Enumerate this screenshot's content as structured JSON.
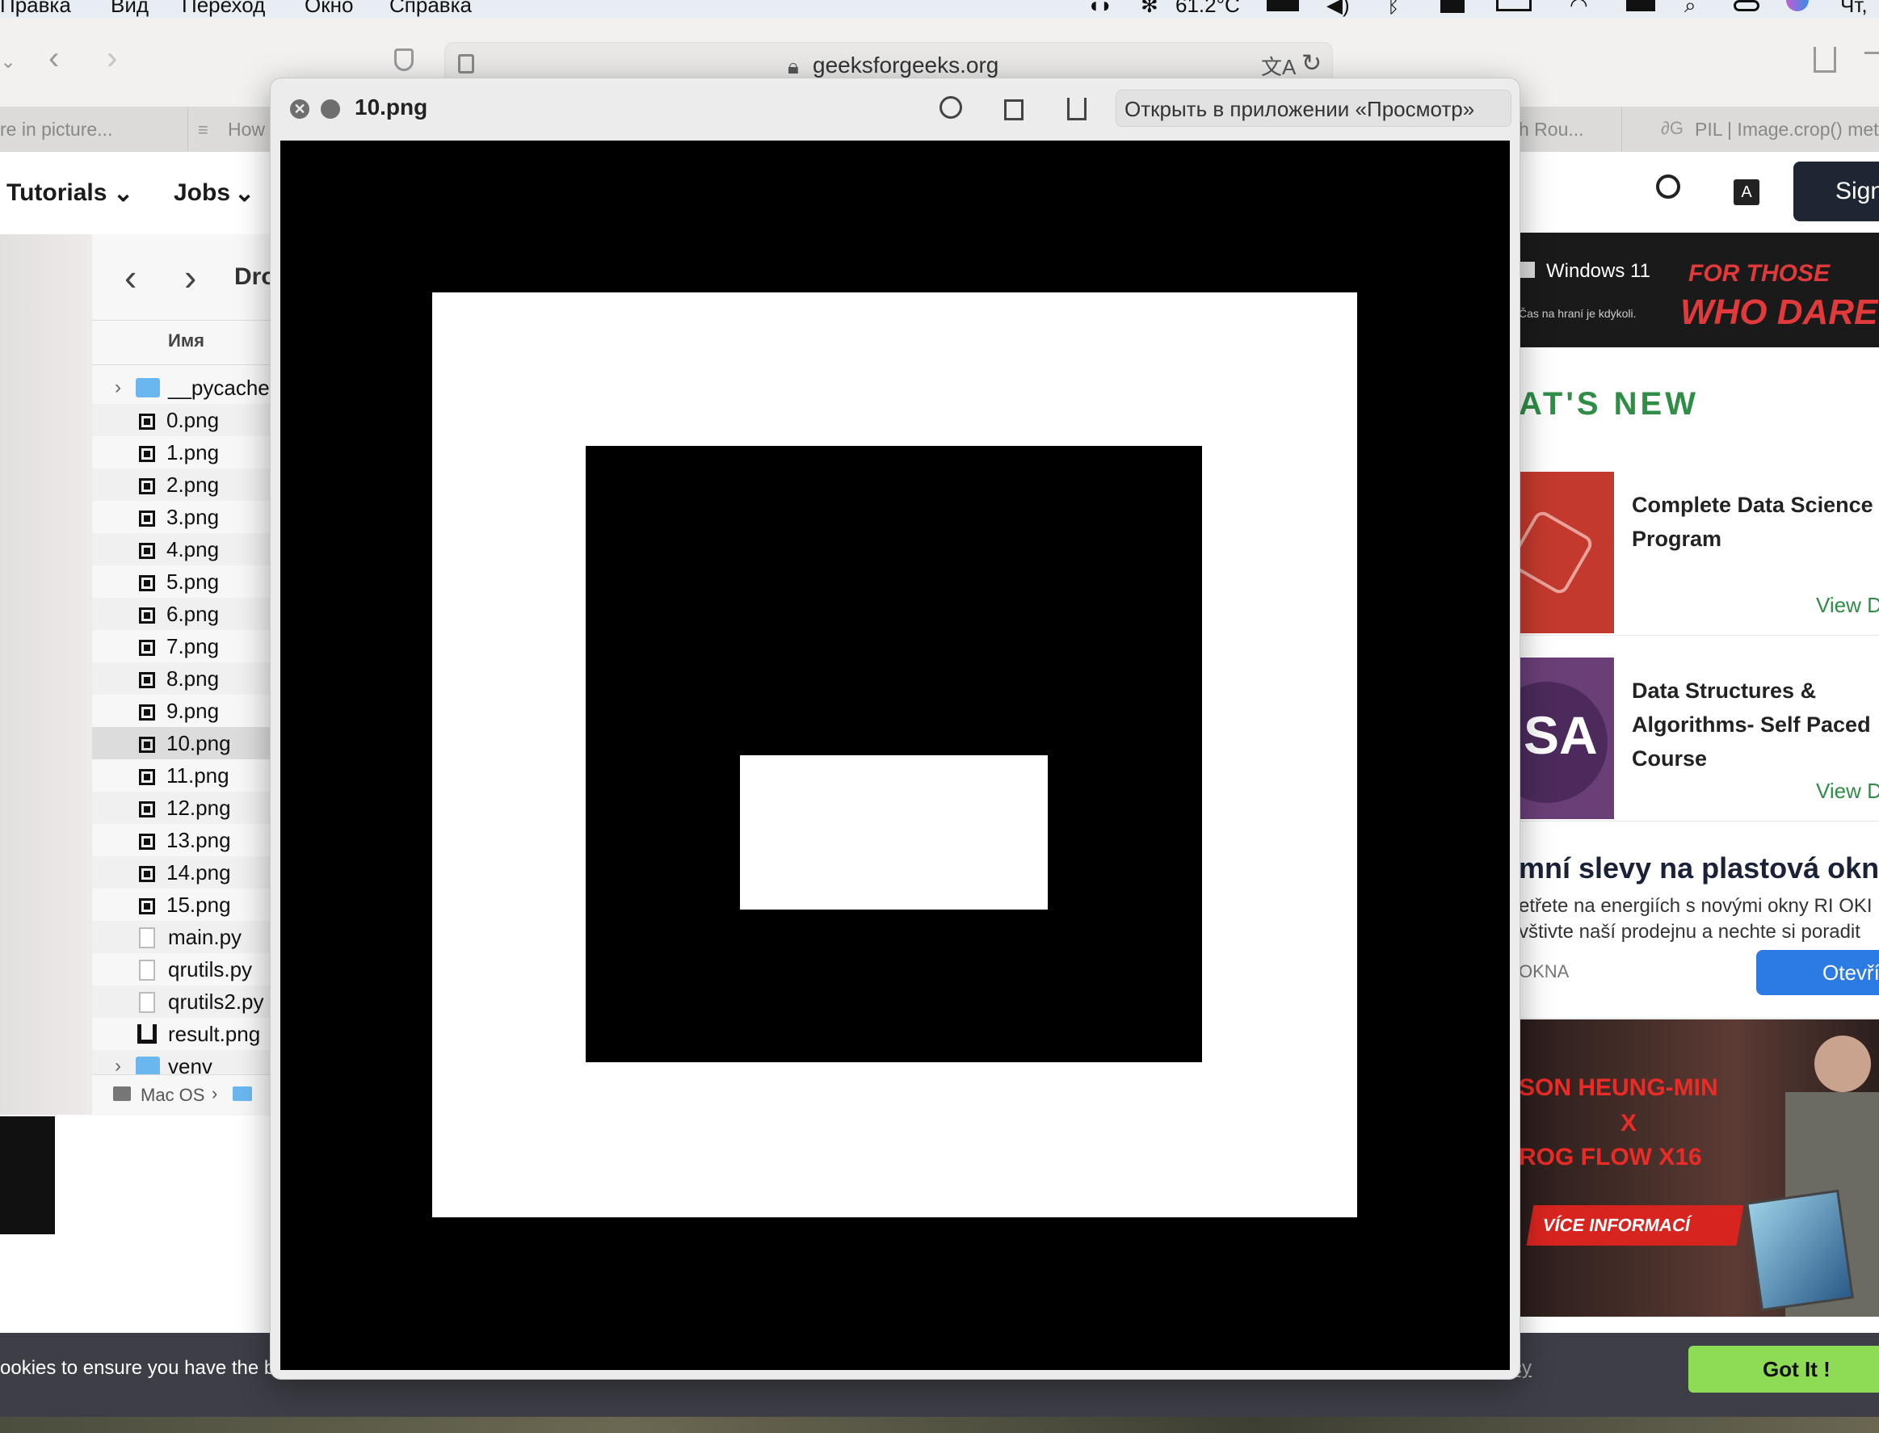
{
  "menubar": {
    "items": [
      "Правка",
      "Вид",
      "Переход",
      "Окно",
      "Справка"
    ],
    "temperature": "61.2°C",
    "clock": "Чт,"
  },
  "browser": {
    "url": "geeksforgeeks.org",
    "tabs": [
      "re in picture...",
      "How",
      "h Rou...",
      "PIL | Image.crop() meth"
    ],
    "nav": {
      "tutorials": "Tutorials",
      "jobs": "Jobs",
      "sign": "Sign"
    }
  },
  "finder": {
    "folder_title": "Dro",
    "column_header": "Имя",
    "files": [
      "__pycache",
      "0.png",
      "1.png",
      "2.png",
      "3.png",
      "4.png",
      "5.png",
      "6.png",
      "7.png",
      "8.png",
      "9.png",
      "10.png",
      "11.png",
      "12.png",
      "13.png",
      "14.png",
      "15.png",
      "main.py",
      "qrutils.py",
      "qrutils2.py",
      "result.png",
      "venv"
    ],
    "selected": "10.png",
    "path": "Mac OS"
  },
  "preview": {
    "title": "10.png",
    "open_button": "Открыть в приложении «Просмотр»"
  },
  "sidebar": {
    "ad_windows": "Windows 11",
    "ad_windows_sub": "Čas na hraní je kdykoli.",
    "ad_dare_top": "FOR THOSE",
    "ad_dare_bottom": "WHO DARE",
    "whats_new": "AT'S NEW",
    "course1_title": "Complete Data Science Program",
    "course1_link": "View D",
    "course2_title": "Data Structures & Algorithms- Self Paced Course",
    "course2_link": "View D",
    "course2_logo": "SA",
    "ad2_title": "mní slevy na plastová okna",
    "ad2_line1": "etřete na energiích s novými okny RI OKI",
    "ad2_line2": "vštivte naší prodejnu a nechte si poradit",
    "ad2_brand": "OKNA",
    "ad2_button": "Otevřít",
    "rog_line1": "SON HEUNG-MIN",
    "rog_line2": "X",
    "rog_line3": "ROG FLOW X16",
    "rog_button": "VÍCE INFORMACÍ"
  },
  "cookie": {
    "text": "ookies to ensure you have the b",
    "policy": "cy",
    "button": "Got It !"
  },
  "colors": {
    "gfg_green": "#2f8d46",
    "got_it": "#8edb55",
    "accent_blue": "#2c7be5"
  }
}
